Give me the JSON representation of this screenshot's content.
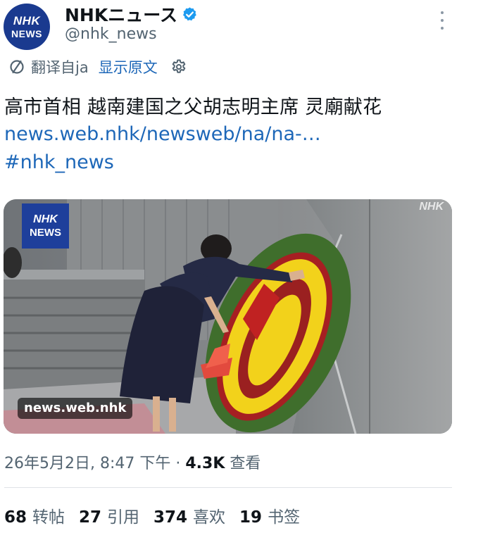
{
  "account": {
    "avatar_line1": "NHK",
    "avatar_line2": "NEWS",
    "name": "NHKニュース",
    "handle": "@nhk_news",
    "verified_icon": "verified-badge-icon",
    "brand_color": "#1a3a8f"
  },
  "translation": {
    "label": "翻译自ja",
    "show_original": "显示原文"
  },
  "tweet": {
    "text": "高市首相 越南建国之父胡志明主席 灵廟献花",
    "link": "news.web.nhk/newsweb/na/na-…",
    "hashtag": "#nhk_news"
  },
  "media": {
    "logo_line1": "NHK",
    "logo_line2": "NEWS",
    "watermark": "NHK",
    "card_domain": "news.web.nhk"
  },
  "meta": {
    "timestamp": "26年5月2日, 8:47 下午",
    "separator": "·",
    "views": "4.3K",
    "views_label": "查看"
  },
  "stats": [
    {
      "count": "68",
      "label": "转帖"
    },
    {
      "count": "27",
      "label": "引用"
    },
    {
      "count": "374",
      "label": "喜欢"
    },
    {
      "count": "19",
      "label": "书签"
    }
  ],
  "colors": {
    "link": "#1d67b8",
    "muted": "#536471",
    "text": "#0f1419",
    "verified": "#1d9bf0"
  }
}
